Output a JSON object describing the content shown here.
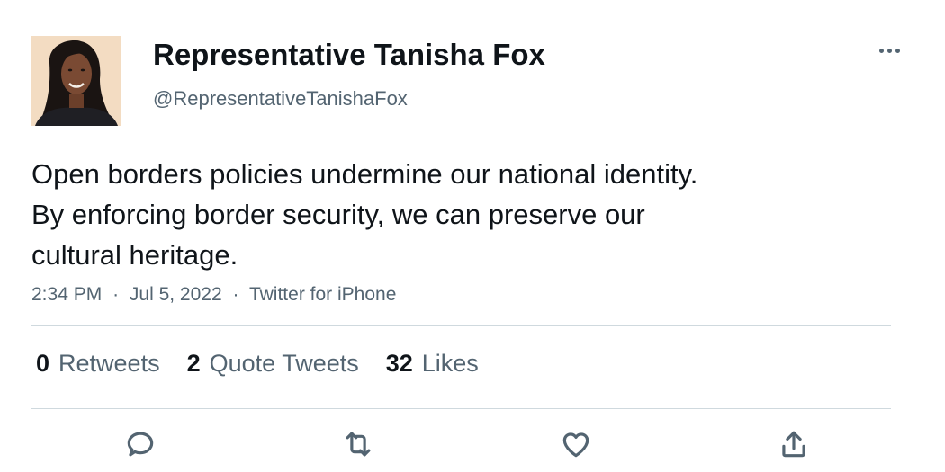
{
  "author": {
    "name": "Representative Tanisha Fox",
    "handle": "@RepresentativeTanishaFox",
    "avatar_icon": "profile-photo"
  },
  "tweet": {
    "lines": [
      "Open borders policies undermine our national identity.",
      "By enforcing border security, we can preserve our",
      "cultural heritage."
    ]
  },
  "meta": {
    "time": "2:34 PM",
    "separator": "·",
    "date": "Jul 5, 2022",
    "source": "Twitter for iPhone"
  },
  "stats": {
    "retweets": {
      "count": "0",
      "label": "Retweets"
    },
    "quotes": {
      "count": "2",
      "label": "Quote Tweets"
    },
    "likes": {
      "count": "32",
      "label": "Likes"
    }
  },
  "actions": {
    "reply_icon": "reply-icon",
    "retweet_icon": "retweet-icon",
    "like_icon": "heart-icon",
    "share_icon": "share-icon"
  },
  "colors": {
    "text_primary": "#0f1419",
    "text_secondary": "#536471",
    "divider": "#cfd9de",
    "background": "#ffffff"
  }
}
